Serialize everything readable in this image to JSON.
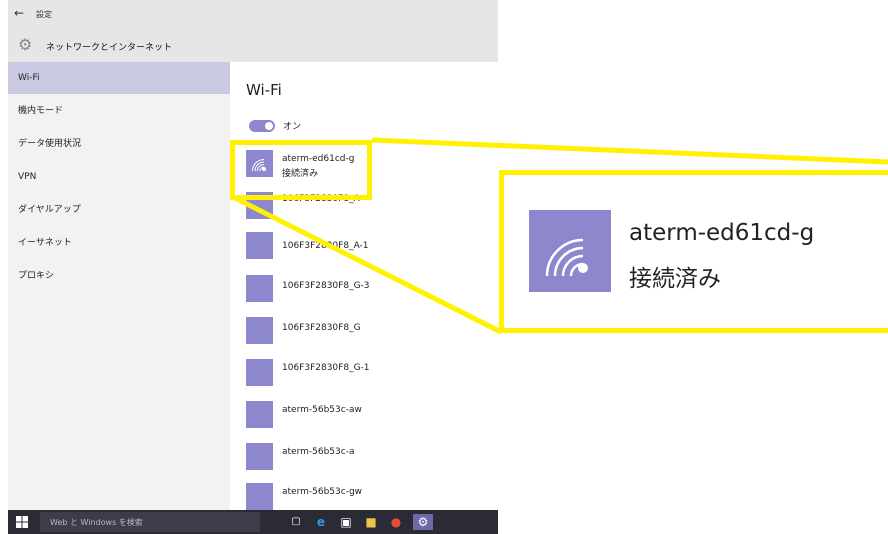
{
  "header": {
    "back_glyph": "←",
    "app_title": "設定",
    "page_title": "ネットワークとインターネット"
  },
  "sidebar": {
    "items": [
      {
        "label": "Wi-Fi",
        "selected": true
      },
      {
        "label": "機内モード"
      },
      {
        "label": "データ使用状況"
      },
      {
        "label": "VPN"
      },
      {
        "label": "ダイヤルアップ"
      },
      {
        "label": "イーサネット"
      },
      {
        "label": "プロキシ"
      }
    ]
  },
  "main": {
    "title": "Wi-Fi",
    "toggle": {
      "state_label": "オン",
      "on": true
    },
    "networks": [
      {
        "ssid": "aterm-ed61cd-g",
        "status": "接続済み"
      },
      {
        "ssid": "106F3F2830F8_A"
      },
      {
        "ssid": "106F3F2830F8_A-1"
      },
      {
        "ssid": "106F3F2830F8_G-3"
      },
      {
        "ssid": "106F3F2830F8_G"
      },
      {
        "ssid": "106F3F2830F8_G-1"
      },
      {
        "ssid": "aterm-56b53c-aw"
      },
      {
        "ssid": "aterm-56b53c-a"
      },
      {
        "ssid": "aterm-56b53c-gw"
      }
    ]
  },
  "taskbar": {
    "search_placeholder": "Web と Windows を検索"
  },
  "callout": {
    "ssid": "aterm-ed61cd-g",
    "status": "接続済み"
  },
  "colors": {
    "accent": "#8d87ce",
    "highlight": "#fff100",
    "taskbar": "#2b2b36",
    "selected_nav": "#c9c9e2"
  }
}
